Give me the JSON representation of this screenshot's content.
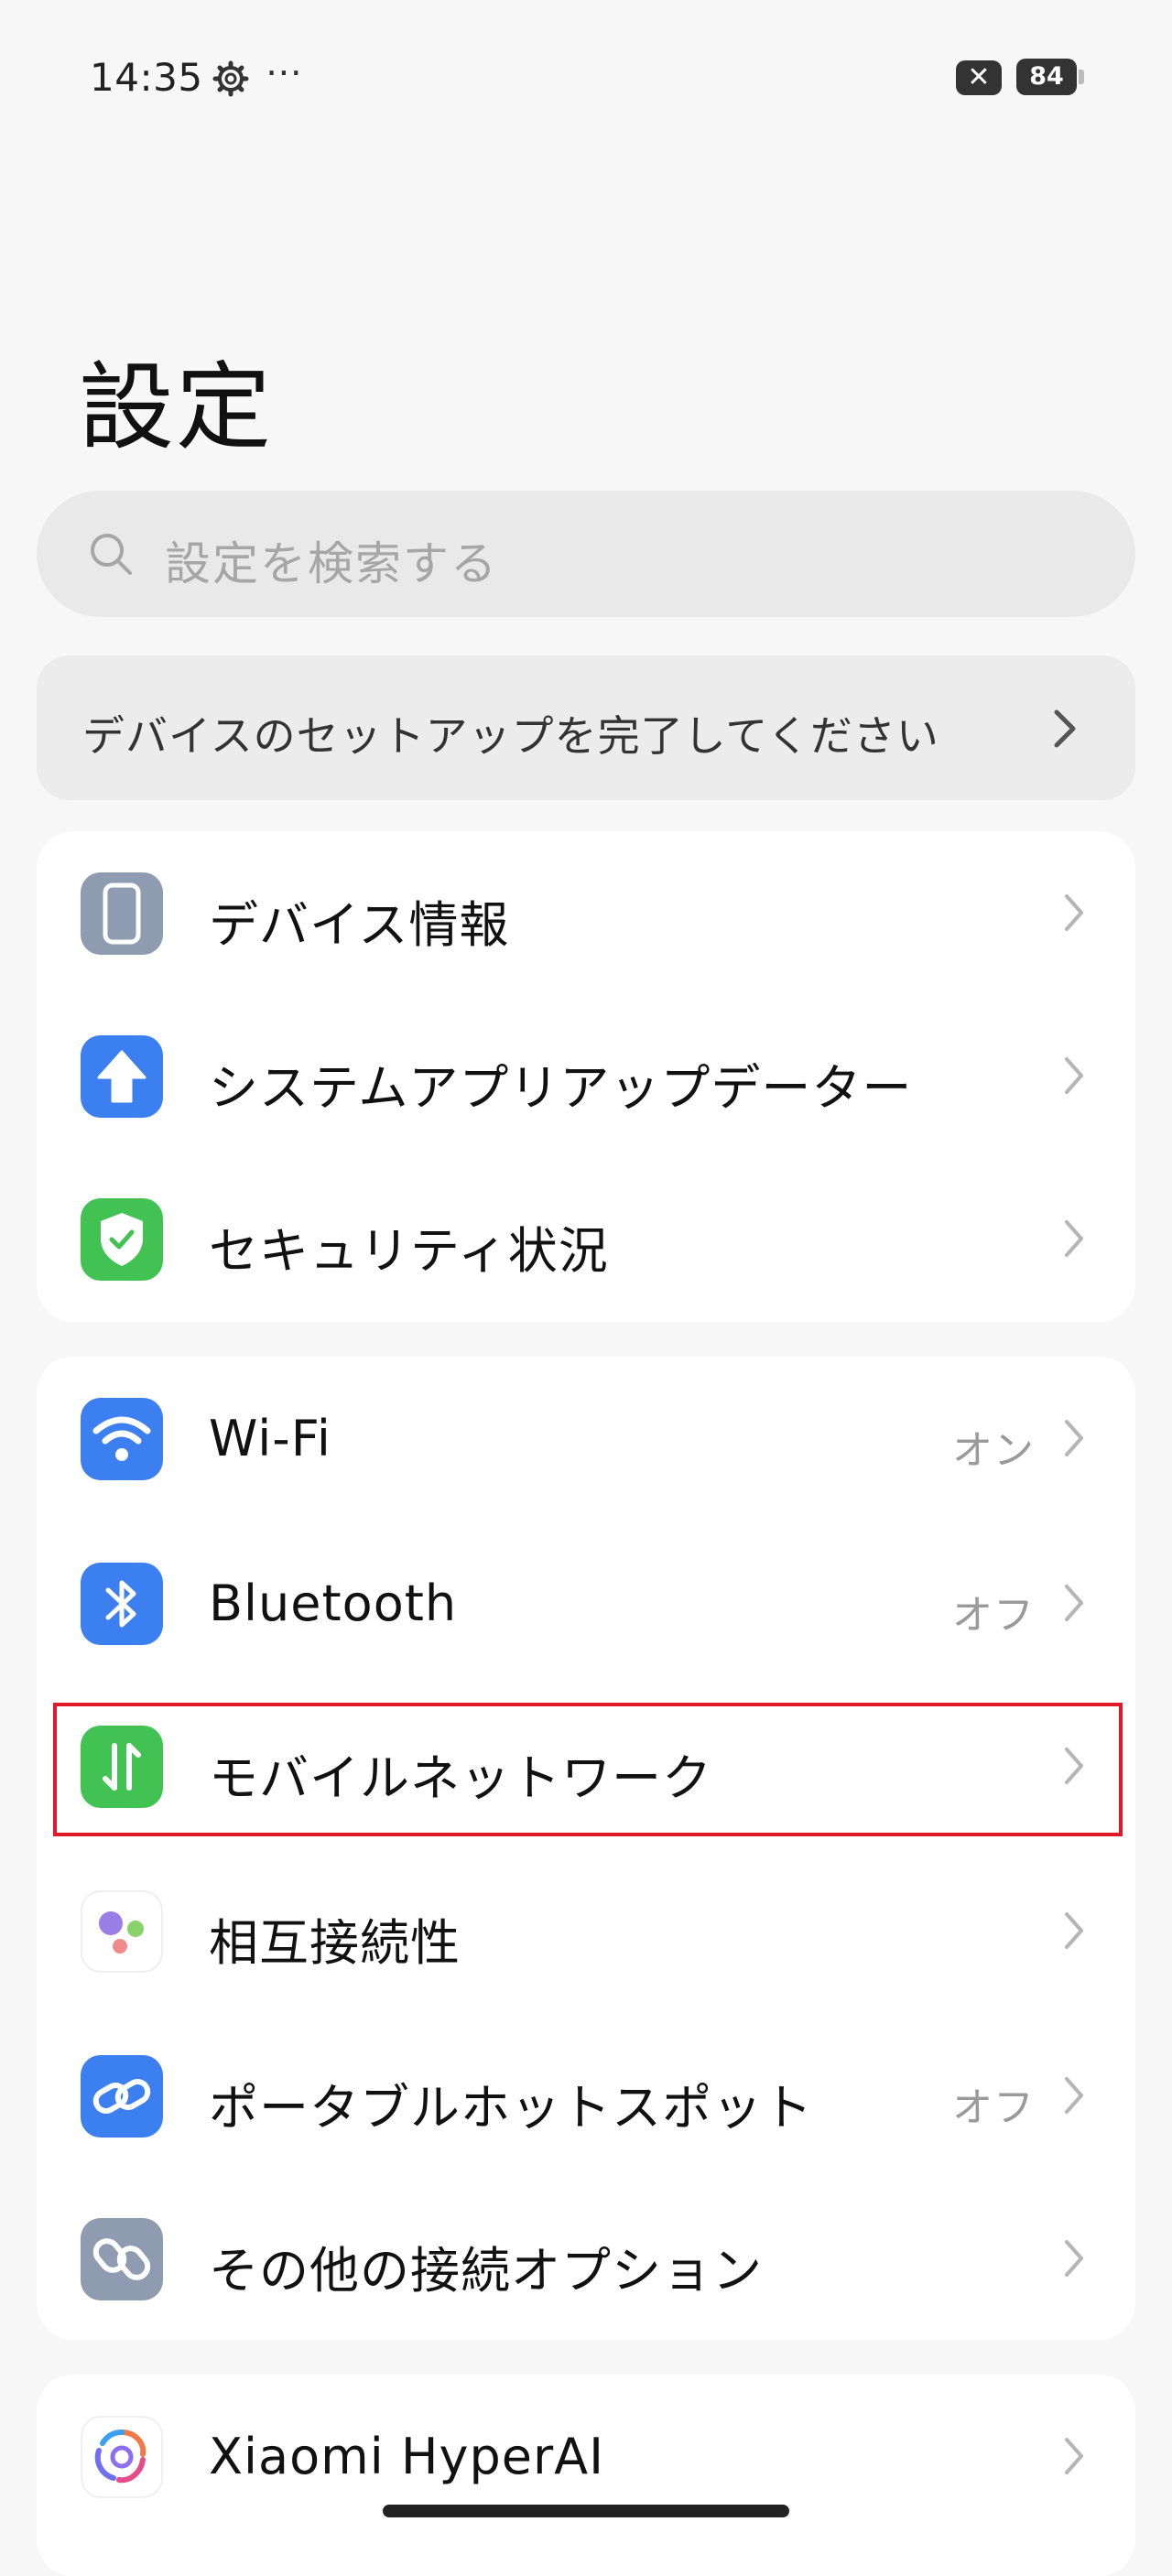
{
  "status_bar": {
    "time": "14:35",
    "more": "⋯",
    "close_badge": "✕",
    "battery": "84"
  },
  "page": {
    "title": "設定"
  },
  "search": {
    "placeholder": "設定を検索する"
  },
  "setup_banner": {
    "text": "デバイスのセットアップを完了してください"
  },
  "group1": {
    "items": [
      {
        "label": "デバイス情報",
        "icon": "device-info-icon",
        "color": "#8e9bb0"
      },
      {
        "label": "システムアプリアップデーター",
        "icon": "upload-arrow-icon",
        "color": "#3c7ff0"
      },
      {
        "label": "セキュリティ状況",
        "icon": "shield-check-icon",
        "color": "#42c252"
      }
    ]
  },
  "group2": {
    "items": [
      {
        "label": "Wi-Fi",
        "value": "オン",
        "icon": "wifi-icon",
        "color": "#3c7ff0"
      },
      {
        "label": "Bluetooth",
        "value": "オフ",
        "icon": "bluetooth-icon",
        "color": "#3c7ff0"
      },
      {
        "label": "モバイルネットワーク",
        "icon": "mobile-data-icon",
        "color": "#42c252"
      },
      {
        "label": "相互接続性",
        "icon": "interconnectivity-icon",
        "color": "#ffffff"
      },
      {
        "label": "ポータブルホットスポット",
        "value": "オフ",
        "icon": "hotspot-link-icon",
        "color": "#3c7ff0"
      },
      {
        "label": "その他の接続オプション",
        "icon": "connection-options-icon",
        "color": "#8e9bb0"
      }
    ]
  },
  "group3": {
    "items": [
      {
        "label": "Xiaomi HyperAI",
        "icon": "hyperai-icon",
        "color": "#ffffff"
      }
    ]
  },
  "colors": {
    "highlight": "#e0192a",
    "background": "#f7f7f7",
    "card": "#ffffff"
  }
}
